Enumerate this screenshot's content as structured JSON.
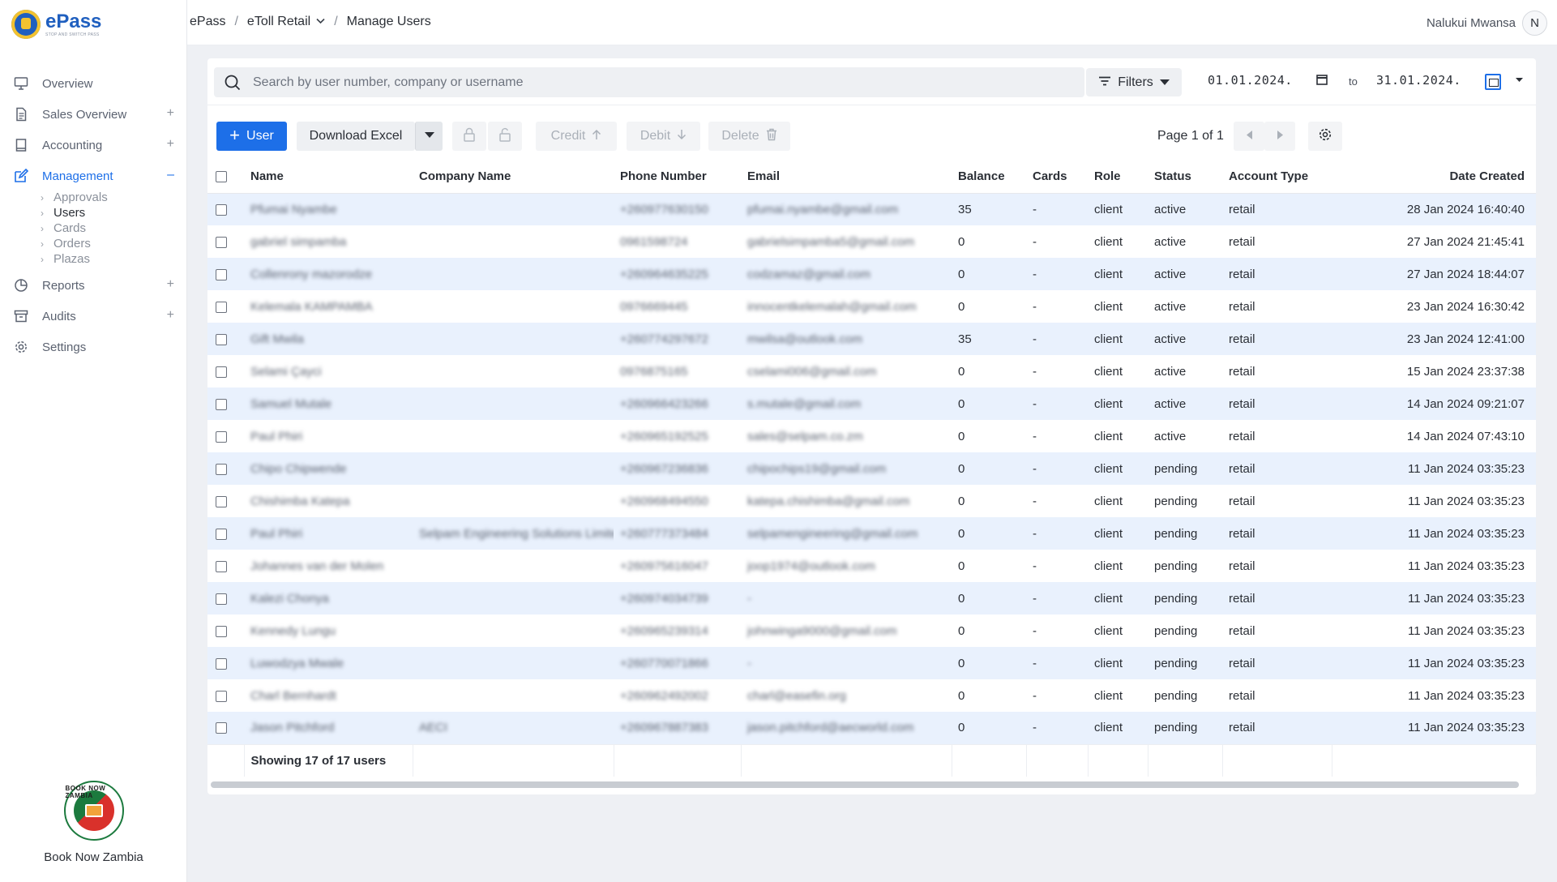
{
  "app": {
    "name": "ePass",
    "tagline": "STOP AND SWITCH PASS"
  },
  "breadcrumb": {
    "root": "ePass",
    "section": "eToll Retail",
    "page": "Manage Users"
  },
  "user": {
    "name": "Nalukui Mwansa",
    "initial": "N"
  },
  "sidebar": {
    "items": [
      {
        "label": "Overview",
        "icon": "monitor-icon"
      },
      {
        "label": "Sales Overview",
        "icon": "document-icon",
        "toggle": "+"
      },
      {
        "label": "Accounting",
        "icon": "book-icon",
        "toggle": "+"
      },
      {
        "label": "Management",
        "icon": "edit-icon",
        "toggle": "–"
      },
      {
        "label": "Reports",
        "icon": "pie-chart-icon",
        "toggle": "+"
      },
      {
        "label": "Audits",
        "icon": "archive-icon",
        "toggle": "+"
      },
      {
        "label": "Settings",
        "icon": "gear-icon"
      }
    ],
    "management_sub": [
      "Approvals",
      "Users",
      "Cards",
      "Orders",
      "Plazas"
    ],
    "footer_brand": "Book Now Zambia",
    "badge_text": "BOOK NOW ZAMBIA"
  },
  "search": {
    "placeholder": "Search by user number, company or username"
  },
  "filters": {
    "label": "Filters",
    "date_from": "01.01.2024.",
    "to_label": "to",
    "date_to": "31.01.2024."
  },
  "toolbar": {
    "add_user": "User",
    "download_excel": "Download Excel",
    "credit": "Credit",
    "debit": "Debit",
    "delete": "Delete",
    "page_label": "Page 1 of 1"
  },
  "table": {
    "columns": [
      "Name",
      "Company Name",
      "Phone Number",
      "Email",
      "Balance",
      "Cards",
      "Role",
      "Status",
      "Account Type",
      "Date Created"
    ],
    "rows": [
      {
        "name": "Pfumai Nyambe",
        "company": "",
        "phone": "+260977630150",
        "email": "pfumai.nyambe@gmail.com",
        "balance": "35",
        "cards": "-",
        "role": "client",
        "status": "active",
        "type": "retail",
        "date": "28 Jan 2024 16:40:40"
      },
      {
        "name": "gabriel simpamba",
        "company": "",
        "phone": "0961598724",
        "email": "gabrielsimpamba5@gmail.com",
        "balance": "0",
        "cards": "-",
        "role": "client",
        "status": "active",
        "type": "retail",
        "date": "27 Jan 2024 21:45:41"
      },
      {
        "name": "Collenrony mazorodze",
        "company": "",
        "phone": "+260964635225",
        "email": "codzamaz@gmail.com",
        "balance": "0",
        "cards": "-",
        "role": "client",
        "status": "active",
        "type": "retail",
        "date": "27 Jan 2024 18:44:07"
      },
      {
        "name": "Kelemala KAMPAMBA",
        "company": "",
        "phone": "0976669445",
        "email": "innocentkelemalah@gmail.com",
        "balance": "0",
        "cards": "-",
        "role": "client",
        "status": "active",
        "type": "retail",
        "date": "23 Jan 2024 16:30:42"
      },
      {
        "name": "Gift Mwila",
        "company": "",
        "phone": "+260774297672",
        "email": "mwilsa@outlook.com",
        "balance": "35",
        "cards": "-",
        "role": "client",
        "status": "active",
        "type": "retail",
        "date": "23 Jan 2024 12:41:00"
      },
      {
        "name": "Selami Çayci",
        "company": "",
        "phone": "0976875165",
        "email": "cselami006@gmail.com",
        "balance": "0",
        "cards": "-",
        "role": "client",
        "status": "active",
        "type": "retail",
        "date": "15 Jan 2024 23:37:38"
      },
      {
        "name": "Samuel Mutale",
        "company": "",
        "phone": "+260966423266",
        "email": "s.mutale@gmail.com",
        "balance": "0",
        "cards": "-",
        "role": "client",
        "status": "active",
        "type": "retail",
        "date": "14 Jan 2024 09:21:07"
      },
      {
        "name": "Paul Phiri",
        "company": "",
        "phone": "+260965192525",
        "email": "sales@selpam.co.zm",
        "balance": "0",
        "cards": "-",
        "role": "client",
        "status": "active",
        "type": "retail",
        "date": "14 Jan 2024 07:43:10"
      },
      {
        "name": "Chipo Chipwende",
        "company": "",
        "phone": "+260967236836",
        "email": "chipochips19@gmail.com",
        "balance": "0",
        "cards": "-",
        "role": "client",
        "status": "pending",
        "type": "retail",
        "date": "11 Jan 2024 03:35:23"
      },
      {
        "name": "Chishimba Katepa",
        "company": "",
        "phone": "+260968494550",
        "email": "katepa.chishimba@gmail.com",
        "balance": "0",
        "cards": "-",
        "role": "client",
        "status": "pending",
        "type": "retail",
        "date": "11 Jan 2024 03:35:23"
      },
      {
        "name": "Paul Phiri",
        "company": "Selpam Engineering Solutions Limited",
        "phone": "+260777373484",
        "email": "selpamengineering@gmail.com",
        "balance": "0",
        "cards": "-",
        "role": "client",
        "status": "pending",
        "type": "retail",
        "date": "11 Jan 2024 03:35:23"
      },
      {
        "name": "Johannes van der Molen",
        "company": "",
        "phone": "+260975616047",
        "email": "joop1974@outlook.com",
        "balance": "0",
        "cards": "-",
        "role": "client",
        "status": "pending",
        "type": "retail",
        "date": "11 Jan 2024 03:35:23"
      },
      {
        "name": "Kalezi Chonya",
        "company": "",
        "phone": "+260974034739",
        "email": "-",
        "balance": "0",
        "cards": "-",
        "role": "client",
        "status": "pending",
        "type": "retail",
        "date": "11 Jan 2024 03:35:23"
      },
      {
        "name": "Kennedy Lungu",
        "company": "",
        "phone": "+260965239314",
        "email": "johnwinga9000@gmail.com",
        "balance": "0",
        "cards": "-",
        "role": "client",
        "status": "pending",
        "type": "retail",
        "date": "11 Jan 2024 03:35:23"
      },
      {
        "name": "Luwodzya Mwale",
        "company": "",
        "phone": "+260770071866",
        "email": "-",
        "balance": "0",
        "cards": "-",
        "role": "client",
        "status": "pending",
        "type": "retail",
        "date": "11 Jan 2024 03:35:23"
      },
      {
        "name": "Charl Bernhardt",
        "company": "",
        "phone": "+260962492002",
        "email": "charl@easefin.org",
        "balance": "0",
        "cards": "-",
        "role": "client",
        "status": "pending",
        "type": "retail",
        "date": "11 Jan 2024 03:35:23"
      },
      {
        "name": "Jason Pitchford",
        "company": "AECI",
        "phone": "+260967887383",
        "email": "jason.pitchford@aecworld.com",
        "balance": "0",
        "cards": "-",
        "role": "client",
        "status": "pending",
        "type": "retail",
        "date": "11 Jan 2024 03:35:23"
      }
    ],
    "footer": "Showing 17 of 17 users"
  },
  "colors": {
    "accent": "#1d6fe8",
    "row_alt": "#e9f1fd",
    "background": "#eef0f4"
  }
}
